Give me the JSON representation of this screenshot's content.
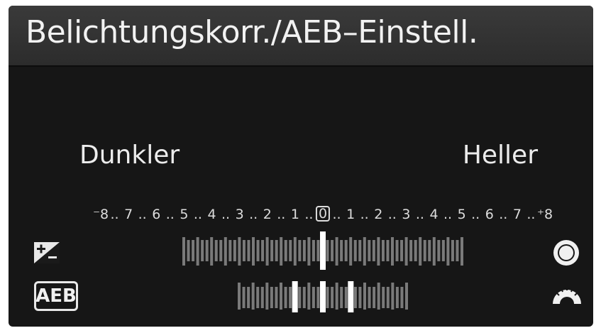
{
  "screen": {
    "title": "Belichtungskorr./AEB–Einstell.",
    "left_label": "Dunkler",
    "right_label": "Heller"
  },
  "scale": {
    "labels": [
      "⁻8",
      "7",
      "6",
      "5",
      "4",
      "3",
      "2",
      "1",
      "0",
      "1",
      "2",
      "3",
      "4",
      "5",
      "6",
      "7",
      "⁺8"
    ],
    "exposure_compensation_value": 0,
    "aeb_bracket_values": [
      -1,
      0,
      1
    ]
  },
  "icons": {
    "exposure_compensation": "exposure-compensation-icon",
    "aeb": "AEB",
    "main_dial": "main-dial-icon",
    "quick_control_dial": "quick-control-dial-icon"
  },
  "colors": {
    "background": "#161616",
    "title_bar": "#2f2f2f",
    "text": "#ececec",
    "tick_inactive": "#7a7a7a",
    "indicator": "#ffffff"
  }
}
